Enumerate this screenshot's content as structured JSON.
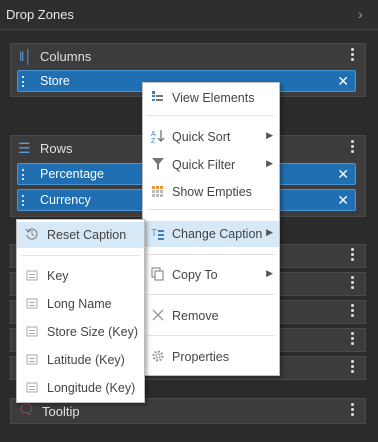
{
  "panel": {
    "title": "Drop Zones"
  },
  "zones": {
    "columns": {
      "title": "Columns",
      "fields": [
        "Store"
      ]
    },
    "rows": {
      "title": "Rows",
      "fields": [
        "Percentage",
        "Currency"
      ]
    },
    "tooltip": {
      "title": "Tooltip"
    }
  },
  "context_menu": {
    "items": [
      {
        "label": "View Elements"
      },
      {
        "label": "Quick Sort"
      },
      {
        "label": "Quick Filter"
      },
      {
        "label": "Show Empties"
      },
      {
        "label": "Change Caption"
      },
      {
        "label": "Copy To"
      },
      {
        "label": "Remove"
      },
      {
        "label": "Properties"
      }
    ]
  },
  "submenu": {
    "items": [
      {
        "label": "Reset Caption"
      },
      {
        "label": "Key"
      },
      {
        "label": "Long Name"
      },
      {
        "label": "Store Size (Key)"
      },
      {
        "label": "Latitude (Key)"
      },
      {
        "label": "Longitude (Key)"
      }
    ]
  },
  "colors": {
    "accent": "#1f6fb2",
    "highlight": "#d7e8f6",
    "background": "#2b2b2b"
  }
}
